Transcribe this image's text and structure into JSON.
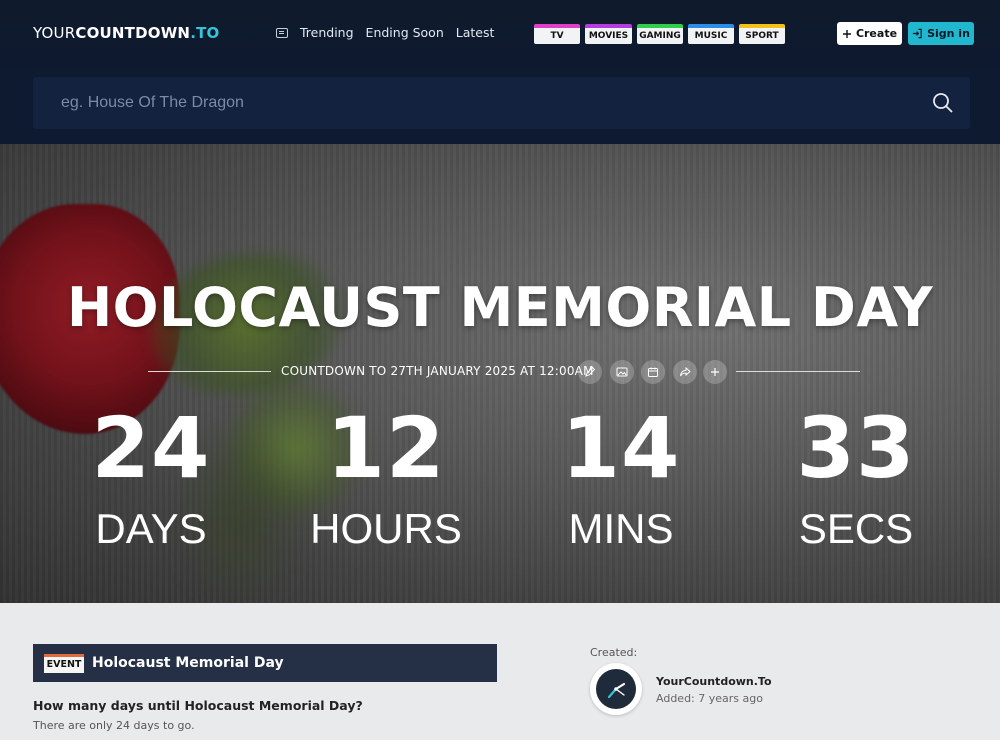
{
  "header": {
    "logo": {
      "part1": "YOUR",
      "part2": "COUNTDOWN",
      "part3": ".TO"
    },
    "nav": [
      "Trending",
      "Ending Soon",
      "Latest"
    ],
    "categories": [
      {
        "label": "TV",
        "color": "#e040c8"
      },
      {
        "label": "MOVIES",
        "color": "#b43ce0"
      },
      {
        "label": "GAMING",
        "color": "#2fcf4b"
      },
      {
        "label": "MUSIC",
        "color": "#2a8ee8"
      },
      {
        "label": "SPORT",
        "color": "#f2c21b"
      }
    ],
    "create_label": "Create",
    "signin_label": "Sign in"
  },
  "search": {
    "placeholder": "eg. House Of The Dragon"
  },
  "hero": {
    "title": "HOLOCAUST MEMORIAL DAY",
    "subtitle": "COUNTDOWN TO 27TH JANUARY 2025 AT 12:00AM",
    "tools": [
      "pencil-icon",
      "image-icon",
      "calendar-icon",
      "share-icon",
      "plus-icon"
    ],
    "countdown": {
      "days": {
        "value": "24",
        "label": "DAYS"
      },
      "hours": {
        "value": "12",
        "label": "HOURS"
      },
      "mins": {
        "value": "14",
        "label": "MINS"
      },
      "secs": {
        "value": "33",
        "label": "SECS"
      }
    }
  },
  "event": {
    "badge": "EVENT",
    "title": "Holocaust Memorial Day",
    "question": "How many days until Holocaust Memorial Day?",
    "answer": "There are only 24 days to go."
  },
  "creator": {
    "created_label": "Created:",
    "name": "YourCountdown.To",
    "added_prefix": "Added:",
    "added": "7 years ago"
  }
}
